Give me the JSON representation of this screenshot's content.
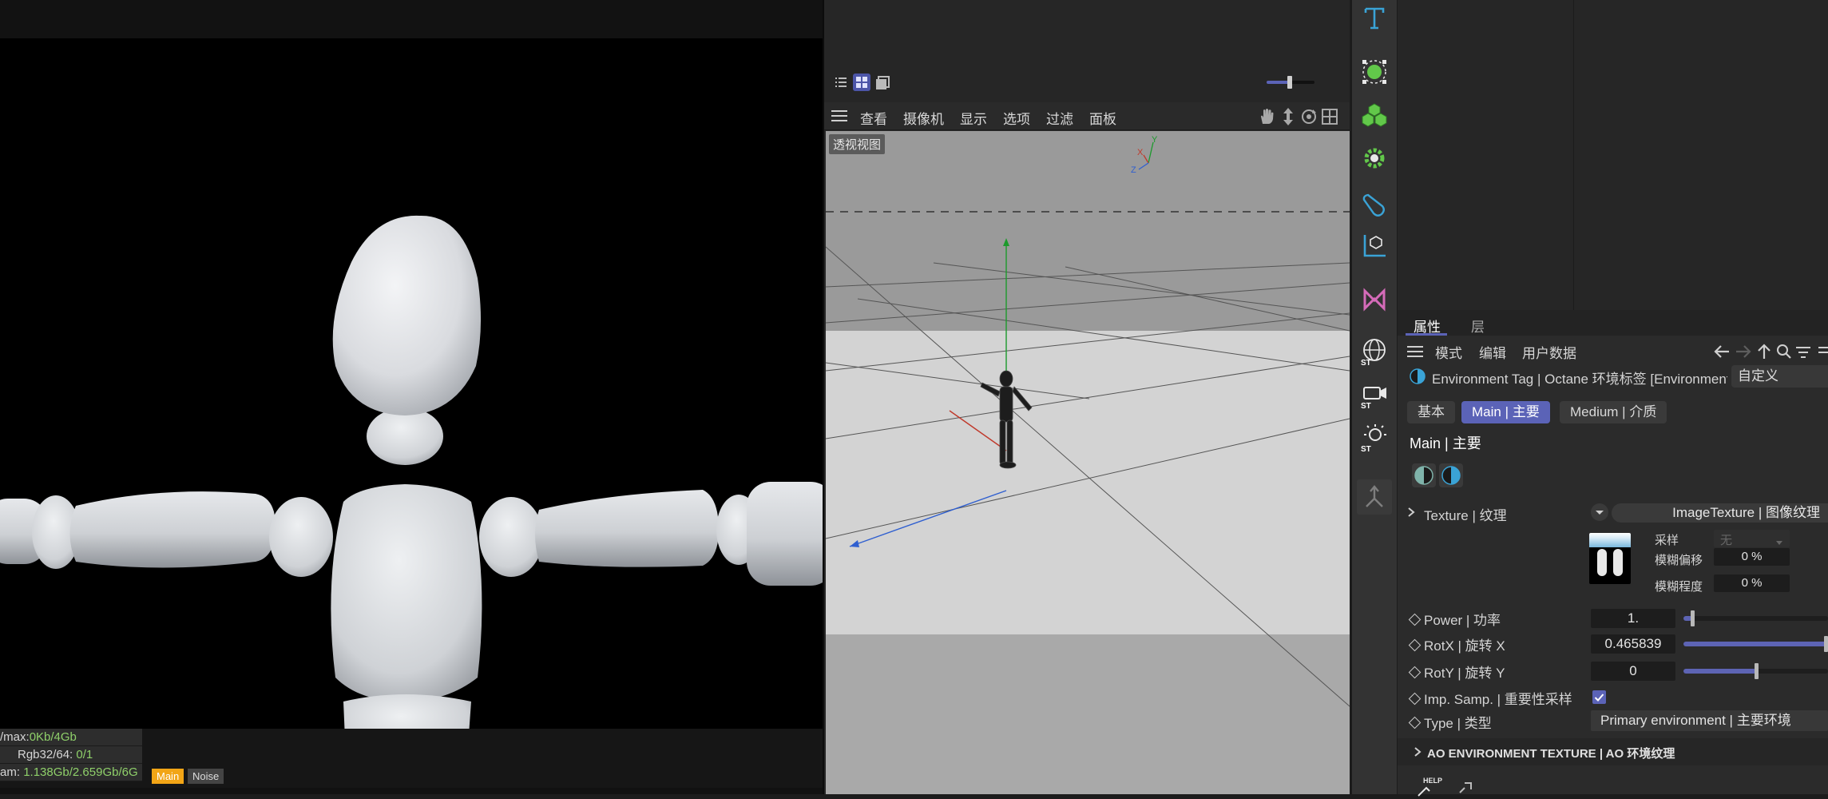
{
  "render": {
    "stats": {
      "vram_label": "/max:",
      "vram_value": "0Kb/4Gb",
      "rgb_label": "Rgb32/64:",
      "rgb_value": "0/1",
      "gram_label": "am:",
      "gram_value": "1.138Gb/2.659Gb/6G"
    },
    "tabs": [
      "Main",
      "Noise"
    ]
  },
  "viewport": {
    "menu": [
      "查看",
      "摄像机",
      "显示",
      "选项",
      "过滤",
      "面板"
    ],
    "label": "透视视图",
    "axis_labels": {
      "x": "X",
      "y": "Y",
      "z": "Z"
    }
  },
  "toolbar": {
    "tools": [
      "text-tool-icon",
      "spline-generator-icon",
      "cube-cloner-icon",
      "gear-deformer-icon",
      "tag-icon",
      "coordinate-icon",
      "mograph-icon",
      "st-sphere-icon",
      "st-camera-icon",
      "st-light-icon",
      "joint-icon"
    ],
    "st_badge": "ST"
  },
  "attributes": {
    "tabs": [
      "属性",
      "层"
    ],
    "menu": [
      "模式",
      "编辑",
      "用户数据"
    ],
    "object_title": "Environment Tag | Octane 环境标签 [Environment Tag",
    "custom_button": "自定义",
    "pills": [
      "基本",
      "Main | 主要",
      "Medium | 介质"
    ],
    "section_title": "Main | 主要",
    "texture": {
      "label": "Texture | 纹理",
      "value": "ImageTexture | 图像纹理",
      "sample_label": "采样",
      "sample_value": "无",
      "blur_offset_label": "模糊偏移",
      "blur_offset_value": "0 %",
      "blur_amount_label": "模糊程度",
      "blur_amount_value": "0 %"
    },
    "params": [
      {
        "label": "Power | 功率",
        "value": "1.",
        "slider": 0.06
      },
      {
        "label": "RotX | 旋转 X",
        "value": "0.465839",
        "slider": 1.0
      },
      {
        "label": "RotY | 旋转 Y",
        "value": "0",
        "slider": 0.5
      }
    ],
    "imp_samp_label": "Imp. Samp. | 重要性采样",
    "imp_samp_checked": true,
    "type_label": "Type | 类型",
    "type_value": "Primary environment | 主要环境",
    "ao_section": "AO ENVIRONMENT TEXTURE | AO 环境纹理",
    "help_label": "HELP"
  },
  "colors": {
    "accent": "#5b63b7",
    "stat_green": "#8fd06a",
    "tab_active": "#f2a516",
    "icon_green": "#62c84a",
    "icon_cyan": "#3aa3d6",
    "icon_pink": "#d56bb9"
  }
}
